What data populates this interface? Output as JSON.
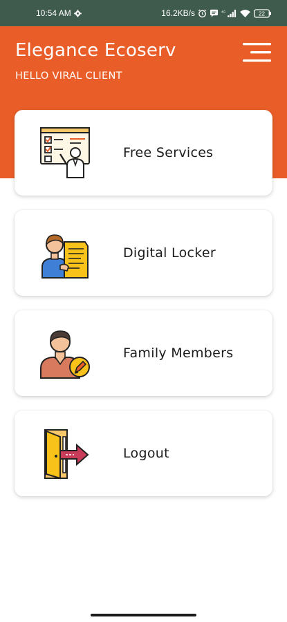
{
  "status_bar": {
    "time": "10:54 AM",
    "network_speed": "16.2KB/s",
    "battery": "22"
  },
  "header": {
    "title": "Elegance Ecoserv",
    "greeting": "HELLO VIRAL CLIENT"
  },
  "menu": {
    "items": [
      {
        "label": "Free Services",
        "icon": "consultant-checklist-icon"
      },
      {
        "label": "Digital Locker",
        "icon": "person-document-icon"
      },
      {
        "label": "Family Members",
        "icon": "user-edit-icon"
      },
      {
        "label": "Logout",
        "icon": "door-exit-icon"
      }
    ]
  },
  "colors": {
    "status_bar": "#3f5b4e",
    "header": "#e95d28",
    "card_background": "#ffffff"
  }
}
